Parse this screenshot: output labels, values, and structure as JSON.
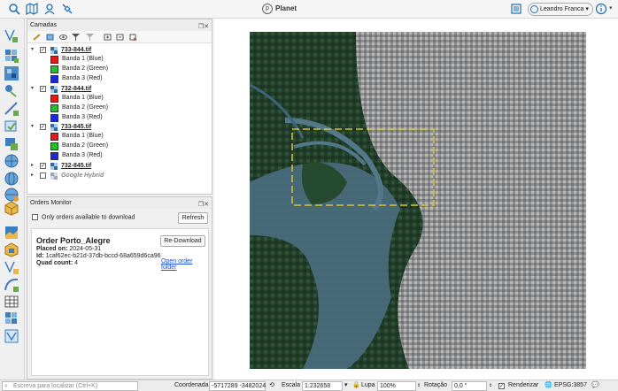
{
  "app": {
    "title": "Planet",
    "logo_letter": "p",
    "user_name": "Leandro Franca",
    "accent": "#1f6fb6"
  },
  "toolbar_icons": [
    "search-icon",
    "map-book-icon",
    "user-pin-icon",
    "satellite-icon"
  ],
  "right_icons": [
    "orders-icon",
    "user-icon",
    "chevron-down-icon",
    "info-icon",
    "chevron-down-icon"
  ],
  "left_tools": [
    "vector-digitize-icon",
    "grid-icon",
    "mosaic-icon",
    "node-icon",
    "line-icon",
    "polygon-check-icon",
    "buffer-icon",
    "globe-icon",
    "globe-2-icon",
    "globe-3-icon",
    "grid-2-icon",
    "box-icon",
    "raster-icon",
    "box-2-icon",
    "vector-2-icon",
    "curve-icon",
    "table-icon",
    "grid-3-icon",
    "vector-3-icon"
  ],
  "layers_panel": {
    "title": "Camadas",
    "layers": [
      {
        "name": "733-844.tif",
        "expanded": true,
        "checked": true,
        "bands": [
          {
            "label": "Banda 1 (Blue)",
            "color": "#e01b1b"
          },
          {
            "label": "Banda 2 (Green)",
            "color": "#22c22a"
          },
          {
            "label": "Banda 3 (Red)",
            "color": "#1a2ad6"
          }
        ]
      },
      {
        "name": "732-844.tif",
        "expanded": true,
        "checked": true,
        "bands": [
          {
            "label": "Banda 1 (Blue)",
            "color": "#e01b1b"
          },
          {
            "label": "Banda 2 (Green)",
            "color": "#22c22a"
          },
          {
            "label": "Banda 3 (Red)",
            "color": "#1a2ad6"
          }
        ]
      },
      {
        "name": "733-845.tif",
        "expanded": true,
        "checked": true,
        "bands": [
          {
            "label": "Banda 1 (Blue)",
            "color": "#e01b1b"
          },
          {
            "label": "Banda 2 (Green)",
            "color": "#22c22a"
          },
          {
            "label": "Banda 3 (Red)",
            "color": "#1a2ad6"
          }
        ]
      },
      {
        "name": "732-845.tif",
        "expanded": false,
        "checked": true,
        "bands": []
      },
      {
        "name": "Google Hybrid",
        "expanded": false,
        "checked": false,
        "bands": []
      }
    ]
  },
  "orders_panel": {
    "title": "Orders Monitor",
    "only_orders_label": "Only orders available to download",
    "refresh_label": "Refresh",
    "order": {
      "title": "Order Porto_Alegre",
      "placed_label": "Placed on:",
      "placed_value": "2024-05-31",
      "id_label": "Id:",
      "id_value": "1caf62ec-b21d-37db-bccd-68a659d6ca96",
      "quad_label": "Quad count:",
      "quad_value": "4",
      "redownload_label": "Re-Download",
      "open_folder_label": "Open order folder"
    }
  },
  "statusbar": {
    "locator_placeholder": "Escreva para localizar (Ctrl+K)",
    "coord_label": "Coordenada",
    "coord_value": "-5717289 -3482024",
    "scale_label": "Escala",
    "scale_value": "1:232658",
    "magnifier_label": "Lupa",
    "magnifier_value": "100%",
    "rotation_label": "Rotação",
    "rotation_value": "0,0 °",
    "render_label": "Renderizar",
    "crs_label": "EPSG:3857"
  }
}
